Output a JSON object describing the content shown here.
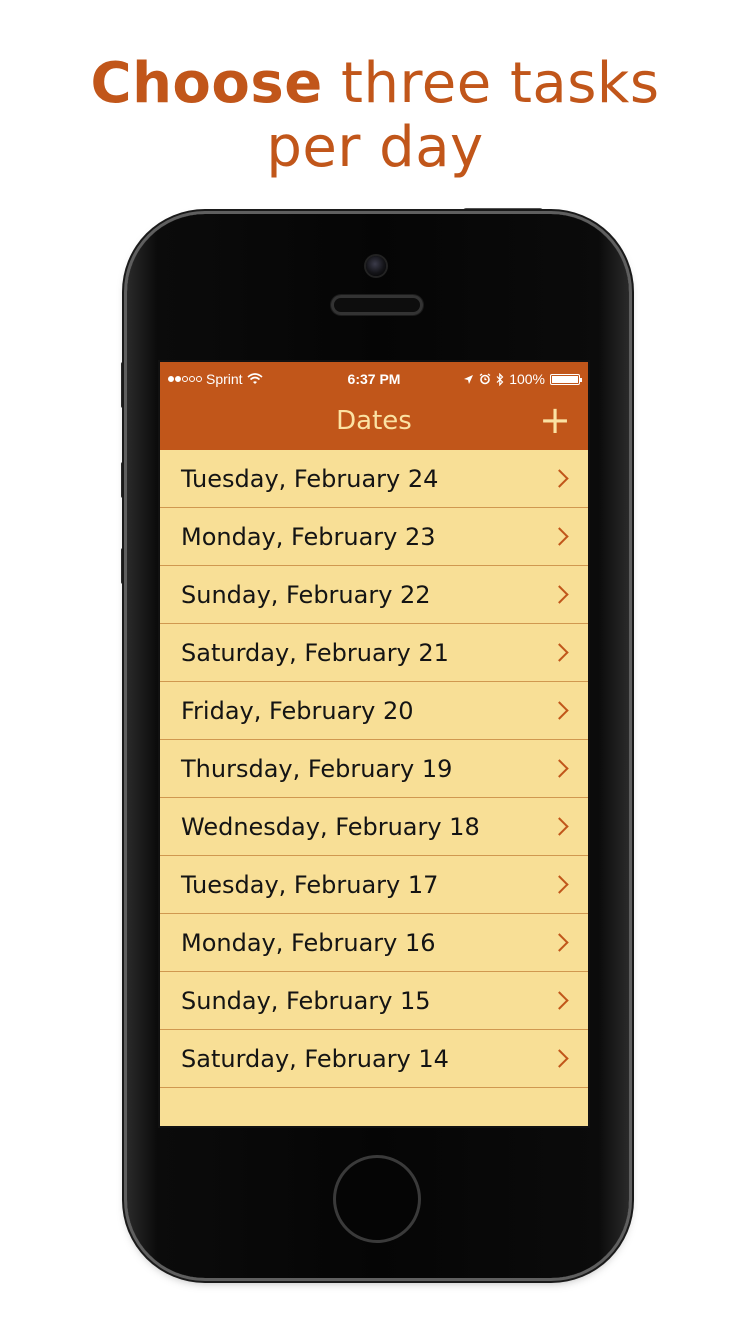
{
  "headline": {
    "bold": "Choose",
    "rest_line1": " three tasks",
    "line2": "per day"
  },
  "status_bar": {
    "carrier": "Sprint",
    "time": "6:37 PM",
    "battery": "100%"
  },
  "nav": {
    "title": "Dates",
    "add_label": "+"
  },
  "dates": [
    "Tuesday, February 24",
    "Monday, February 23",
    "Sunday, February 22",
    "Saturday, February 21",
    "Friday, February 20",
    "Thursday, February 19",
    "Wednesday, February 18",
    "Tuesday, February 17",
    "Monday, February 16",
    "Sunday, February 15",
    "Saturday, February 14"
  ],
  "colors": {
    "accent": "#c1561a",
    "list_background": "#f8df96",
    "title_text": "#fbe2a3"
  },
  "icons": {
    "row_chevron": "chevron-right-icon",
    "add": "plus-icon"
  }
}
